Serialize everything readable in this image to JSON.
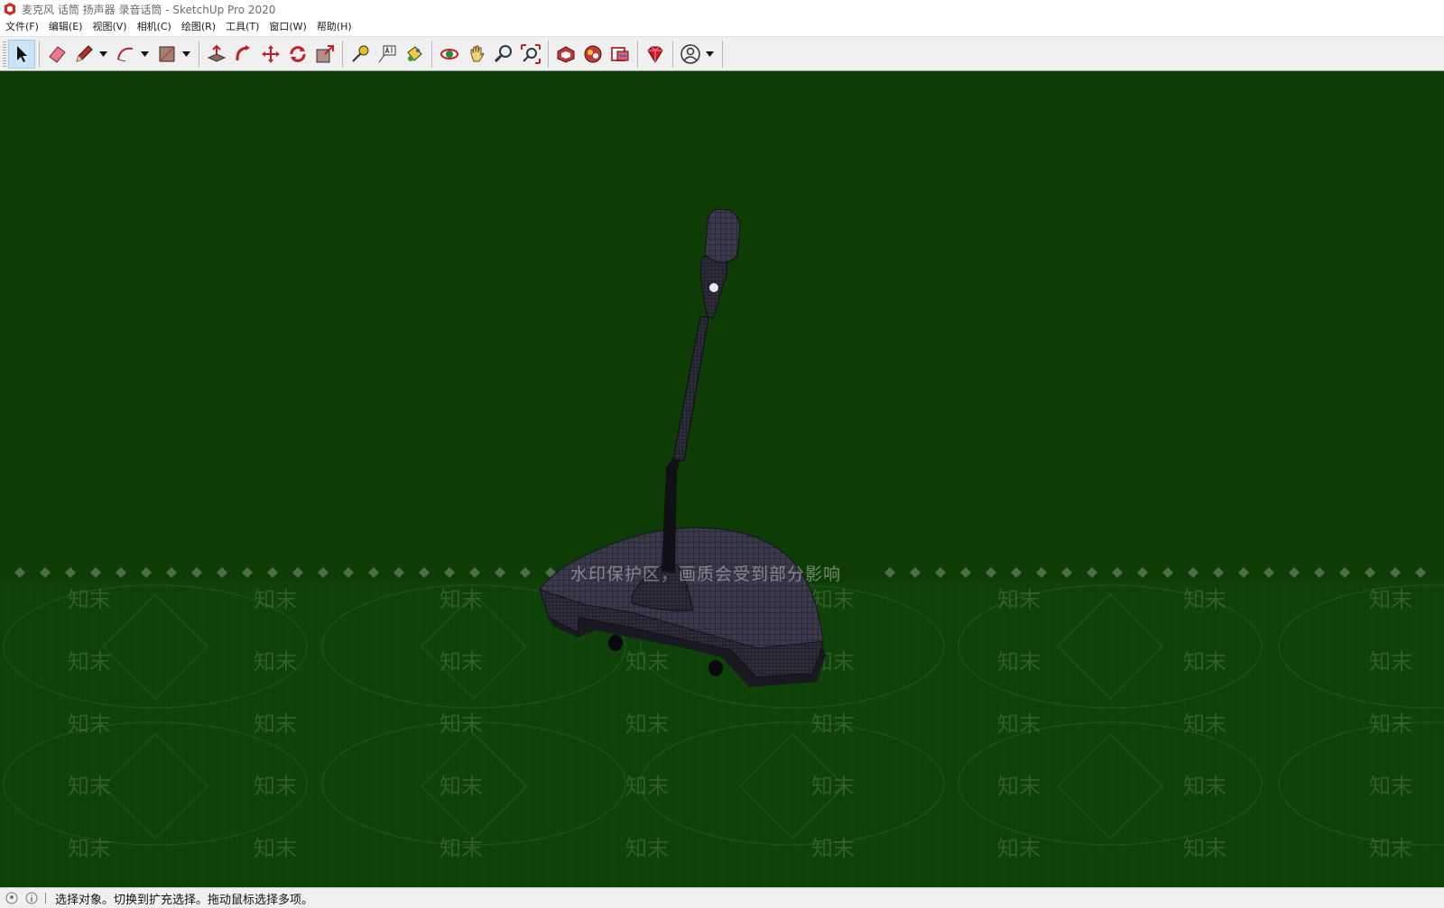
{
  "window": {
    "title": "麦克风 话筒 扬声器 录音话筒 - SketchUp Pro 2020",
    "icon": "sketchup-logo-icon"
  },
  "menu": [
    {
      "id": "file",
      "label": "文件(F)"
    },
    {
      "id": "edit",
      "label": "编辑(E)"
    },
    {
      "id": "view",
      "label": "视图(V)"
    },
    {
      "id": "camera",
      "label": "相机(C)"
    },
    {
      "id": "draw",
      "label": "绘图(R)"
    },
    {
      "id": "tools",
      "label": "工具(T)"
    },
    {
      "id": "window",
      "label": "窗口(W)"
    },
    {
      "id": "help",
      "label": "帮助(H)"
    }
  ],
  "toolbar": {
    "active_tool": "select",
    "tools": [
      "select",
      "eraser",
      "pencil",
      "arc",
      "rectangle",
      "push-pull",
      "follow-me",
      "move",
      "rotate",
      "scale",
      "tape-measure",
      "text",
      "paint-bucket",
      "orbit",
      "pan",
      "zoom",
      "zoom-extents",
      "3d-warehouse",
      "extension-warehouse",
      "layout",
      "extension-manager",
      "account"
    ]
  },
  "watermark": {
    "caption": "水印保护区，画质会受到部分影响",
    "brand": "知末"
  },
  "status": {
    "message": "选择对象。切换到扩充选择。拖动鼠标选择多项。"
  },
  "colors": {
    "viewport_background": "#0d3d04",
    "model_color": "#3a3a4a",
    "toolbar_active": "#cce4f7"
  }
}
